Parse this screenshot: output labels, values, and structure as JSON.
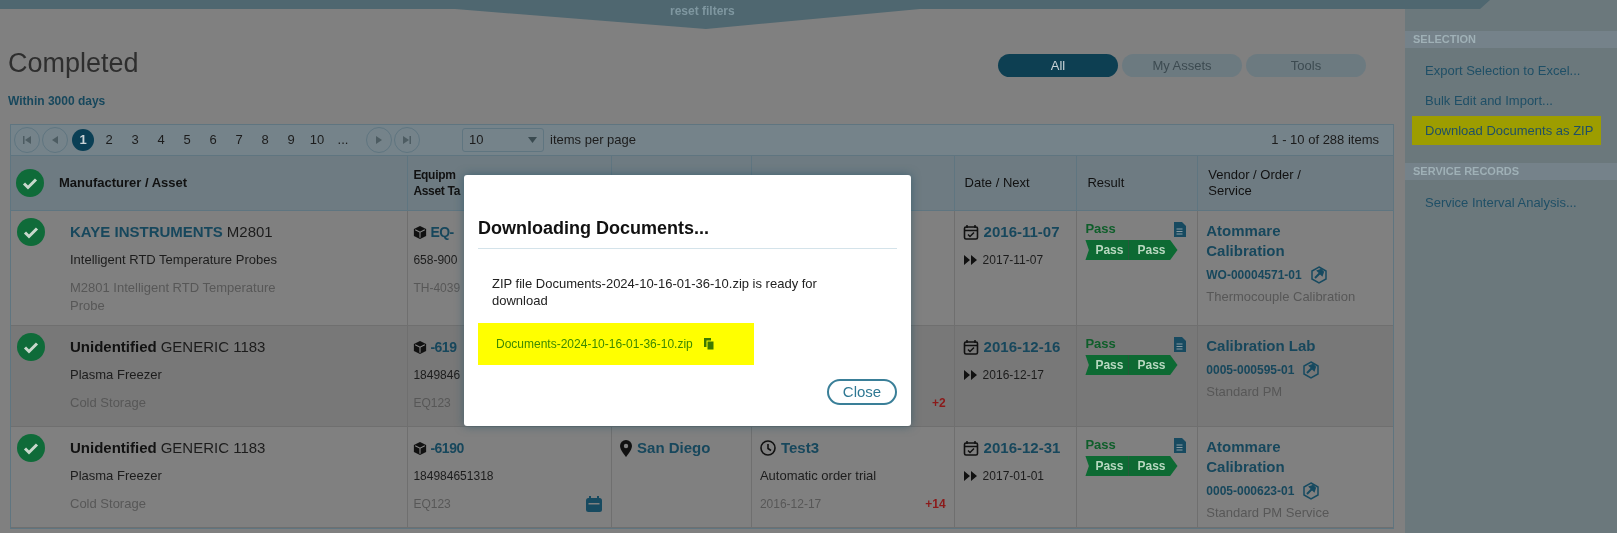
{
  "filter_bar": {
    "label": "reset filters"
  },
  "page": {
    "title": "Completed",
    "subtitle": "Within 3000 days"
  },
  "tabs": [
    {
      "label": "All",
      "selected": true
    },
    {
      "label": "My Assets",
      "selected": false
    },
    {
      "label": "Tools",
      "selected": false
    }
  ],
  "pager": {
    "pages": [
      {
        "label": "1",
        "selected": true
      },
      {
        "label": "2",
        "selected": false
      },
      {
        "label": "3",
        "selected": false
      },
      {
        "label": "4",
        "selected": false
      },
      {
        "label": "5",
        "selected": false
      },
      {
        "label": "6",
        "selected": false
      },
      {
        "label": "7",
        "selected": false
      },
      {
        "label": "8",
        "selected": false
      },
      {
        "label": "9",
        "selected": false
      },
      {
        "label": "10",
        "selected": false
      },
      {
        "label": "...",
        "selected": false
      }
    ],
    "page_size": "10",
    "page_size_label": "items per page",
    "summary": "1 - 10 of 288 items"
  },
  "table": {
    "select_all_checked": true,
    "columns": [
      {
        "lines": [
          "Manufacturer / Asset"
        ]
      },
      {
        "lines": [
          "Equipm",
          "Asset Ta"
        ]
      },
      {
        "lines": [
          "Date / Next"
        ]
      },
      {
        "lines": [
          "Result"
        ]
      },
      {
        "lines": [
          "Vendor / Order /",
          "Service"
        ]
      }
    ],
    "rows": [
      {
        "checked": true,
        "unidentified": false,
        "manufacturer": "KAYE INSTRUMENTS",
        "model": "M2801",
        "description": "Intelligent RTD Temperature Probes",
        "detail": "M2801 Intelligent RTD Temperature Probe",
        "equipment_id": "EQ-",
        "serial": "658-900",
        "asset_tag": "TH-4039",
        "scheduled": false,
        "date": "2016-11-07",
        "next": "2017-11-07",
        "result": "Pass",
        "tags": [
          "Pass",
          "Pass"
        ],
        "vendor": "Atommare Calibration",
        "order": "WO-00004571-01",
        "service": "Thermocouple Calibration"
      },
      {
        "checked": true,
        "unidentified": true,
        "manufacturer": "Unidentified",
        "model": "GENERIC 1183",
        "description": "Plasma Freezer",
        "detail": "Cold Storage",
        "equipment_id": "-619",
        "serial": "1849846",
        "asset_tag": "EQ123",
        "scheduled": false,
        "extra_count": "+2",
        "date": "2016-12-16",
        "next": "2016-12-17",
        "result": "Pass",
        "tags": [
          "Pass",
          "Pass"
        ],
        "vendor": "Calibration Lab",
        "order": "0005-000595-01",
        "service": "Standard PM"
      },
      {
        "checked": true,
        "unidentified": true,
        "manufacturer": "Unidentified",
        "model": "GENERIC 1183",
        "description": "Plasma Freezer",
        "detail": "Cold Storage",
        "equipment_id": "-6190",
        "serial": "184984651318",
        "asset_tag": "EQ123",
        "scheduled": true,
        "location": "San Diego",
        "order_name": "Test3",
        "order_description": "Automatic order trial",
        "order_date": "2016-12-17",
        "extra_count": "+14",
        "date": "2016-12-31",
        "next": "2017-01-01",
        "result": "Pass",
        "tags": [
          "Pass",
          "Pass"
        ],
        "vendor": "Atommare Calibration",
        "order": "0005-000623-01",
        "service": "Standard PM Service"
      }
    ]
  },
  "sidebar": {
    "sections": [
      {
        "title": "SELECTION",
        "items": [
          {
            "label": "Export Selection to Excel...",
            "highlighted": false
          },
          {
            "label": "Bulk Edit and Import...",
            "highlighted": false
          },
          {
            "label": "Download Documents as ZIP",
            "highlighted": true
          }
        ]
      },
      {
        "title": "SERVICE RECORDS",
        "items": [
          {
            "label": "Service Interval Analysis...",
            "highlighted": false
          }
        ]
      }
    ]
  },
  "dialog": {
    "title": "Downloading Documents...",
    "message": "ZIP file Documents-2024-10-16-01-36-10.zip is ready for download",
    "link": "Documents-2024-10-16-01-36-10.zip",
    "close": "Close"
  }
}
